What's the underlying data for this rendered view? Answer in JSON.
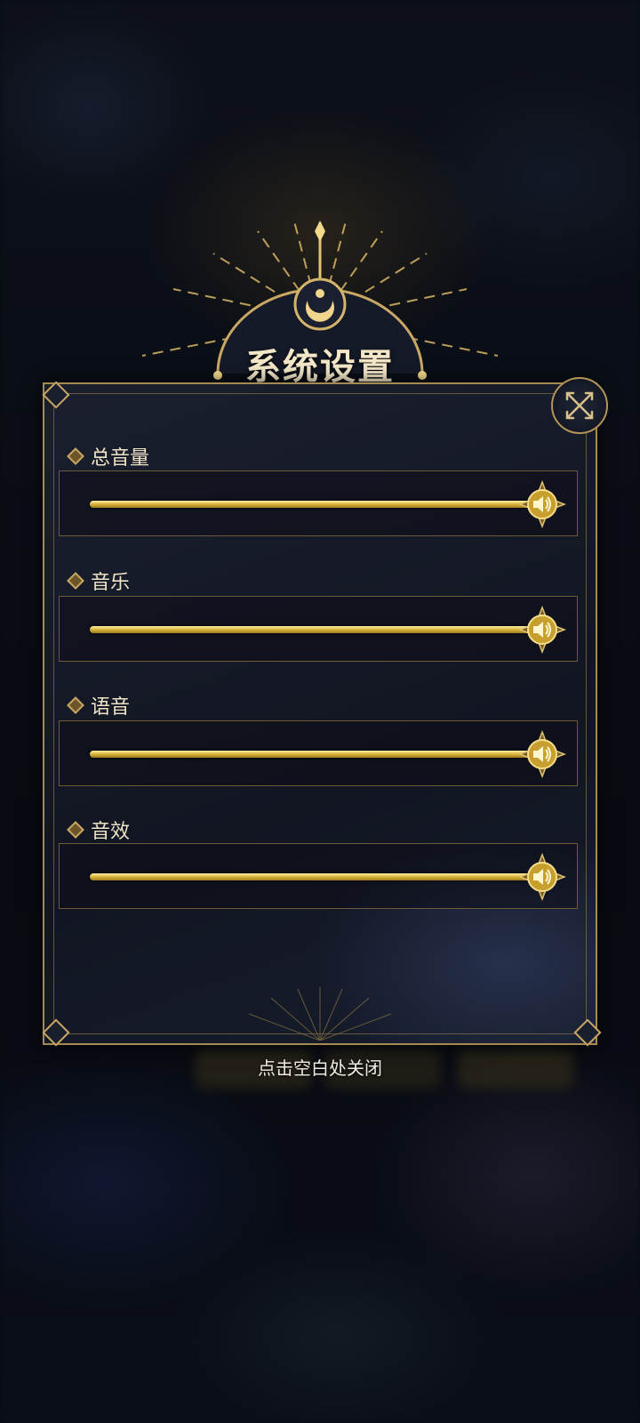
{
  "dialog": {
    "title": "系统设置"
  },
  "settings": [
    {
      "label": "总音量",
      "value": 1.0
    },
    {
      "label": "音乐",
      "value": 1.0
    },
    {
      "label": "语音",
      "value": 1.0
    },
    {
      "label": "音效",
      "value": 1.0
    }
  ],
  "hint": "点击空白处关闭",
  "colors": {
    "gold": "#d8b338",
    "frame": "#a58a52",
    "panel": "#141826",
    "text": "#efe4c8"
  },
  "icons": {
    "close": "close-icon",
    "speaker": "speaker-icon",
    "crest": "moon-crest-icon"
  }
}
